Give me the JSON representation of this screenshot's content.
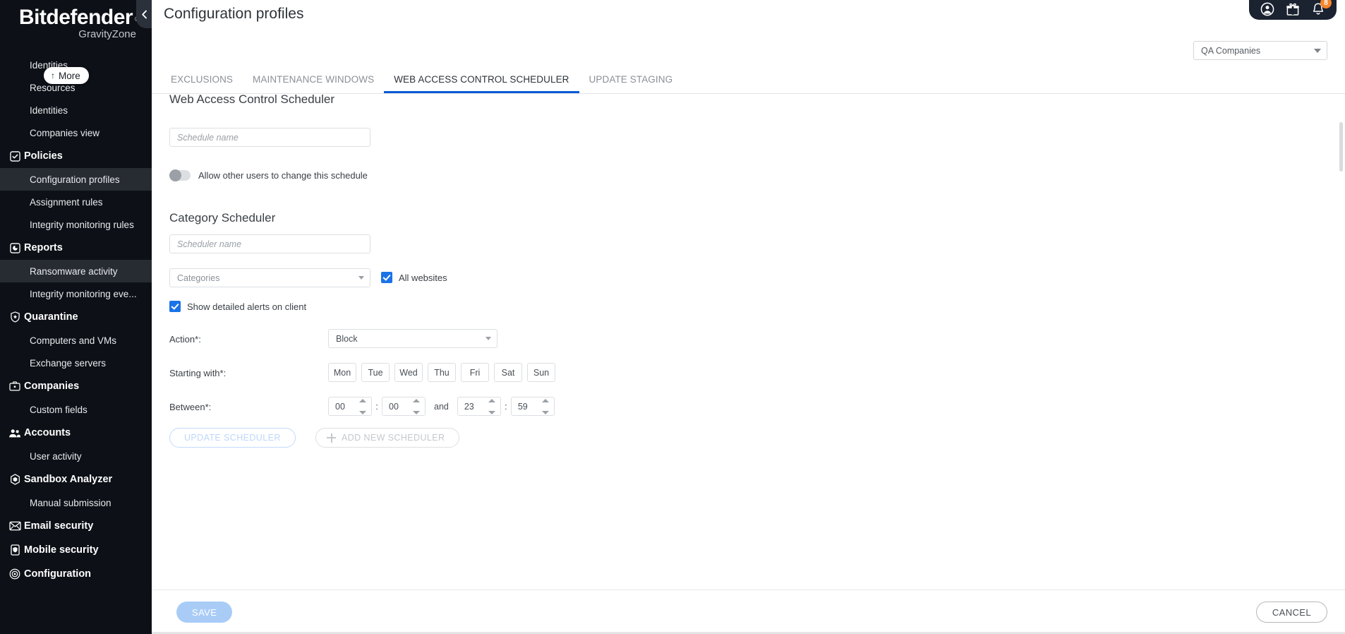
{
  "brand": {
    "name": "Bitdefender",
    "registered": "®",
    "product": "GravityZone"
  },
  "sidebar": {
    "more_pill": {
      "arrow": "↑",
      "label": "More"
    },
    "items": [
      {
        "label": "Identities",
        "type": "sub",
        "icon": "",
        "active": false
      },
      {
        "label": "Resources",
        "type": "sub",
        "icon": "",
        "active": false
      },
      {
        "label": "Identities",
        "type": "sub",
        "icon": "",
        "active": false
      },
      {
        "label": "Companies view",
        "type": "sub",
        "icon": "",
        "active": false
      },
      {
        "label": "Policies",
        "type": "group",
        "icon": "policies-icon",
        "active": false
      },
      {
        "label": "Configuration profiles",
        "type": "sub",
        "icon": "",
        "active": true
      },
      {
        "label": "Assignment rules",
        "type": "sub",
        "icon": "",
        "active": false
      },
      {
        "label": "Integrity monitoring rules",
        "type": "sub",
        "icon": "",
        "active": false
      },
      {
        "label": "Reports",
        "type": "group",
        "icon": "reports-icon",
        "active": false
      },
      {
        "label": "Ransomware activity",
        "type": "sub",
        "icon": "",
        "active": true
      },
      {
        "label": "Integrity monitoring eve...",
        "type": "sub",
        "icon": "",
        "active": false
      },
      {
        "label": "Quarantine",
        "type": "group",
        "icon": "quarantine-icon",
        "active": false
      },
      {
        "label": "Computers and VMs",
        "type": "sub",
        "icon": "",
        "active": false
      },
      {
        "label": "Exchange servers",
        "type": "sub",
        "icon": "",
        "active": false
      },
      {
        "label": "Companies",
        "type": "group",
        "icon": "companies-icon",
        "active": false
      },
      {
        "label": "Custom fields",
        "type": "sub",
        "icon": "",
        "active": false
      },
      {
        "label": "Accounts",
        "type": "group",
        "icon": "accounts-icon",
        "active": false
      },
      {
        "label": "User activity",
        "type": "sub",
        "icon": "",
        "active": false
      },
      {
        "label": "Sandbox Analyzer",
        "type": "group",
        "icon": "sandbox-icon",
        "active": false
      },
      {
        "label": "Manual submission",
        "type": "sub",
        "icon": "",
        "active": false
      },
      {
        "label": "Email security",
        "type": "group",
        "icon": "email-icon",
        "active": false
      },
      {
        "label": "Mobile security",
        "type": "group",
        "icon": "mobile-icon",
        "active": false
      },
      {
        "label": "Configuration",
        "type": "group",
        "icon": "configuration-icon",
        "active": false
      }
    ]
  },
  "topbar": {
    "notifications_badge": "8",
    "icons": [
      "account-icon",
      "gift-icon",
      "bell-icon"
    ]
  },
  "header": {
    "title": "Configuration profiles",
    "company_filter": "QA Companies"
  },
  "tabs": [
    {
      "label": "EXCLUSIONS",
      "active": false
    },
    {
      "label": "MAINTENANCE WINDOWS",
      "active": false
    },
    {
      "label": "WEB ACCESS CONTROL SCHEDULER",
      "active": true
    },
    {
      "label": "UPDATE STAGING",
      "active": false
    }
  ],
  "content": {
    "heading": "Web Access Control Scheduler",
    "schedule_name_placeholder": "Schedule name",
    "schedule_name_value": "",
    "allow_other_users_label": "Allow other users to change this schedule",
    "allow_other_users_on": false,
    "category_scheduler_heading": "Category Scheduler",
    "scheduler_name_placeholder": "Scheduler name",
    "scheduler_name_value": "",
    "categories_placeholder": "Categories",
    "all_websites_label": "All websites",
    "all_websites_checked": true,
    "show_detailed_alerts_label": "Show detailed alerts on client",
    "show_detailed_alerts_checked": true,
    "action_label": "Action*:",
    "action_value": "Block",
    "starting_with_label": "Starting with*:",
    "days": [
      "Mon",
      "Tue",
      "Wed",
      "Thu",
      "Fri",
      "Sat",
      "Sun"
    ],
    "between_label": "Between*:",
    "time": {
      "start_hour": "00",
      "start_minute": "00",
      "and": "and",
      "end_hour": "23",
      "end_minute": "59",
      "separator": ":"
    },
    "update_scheduler_label": "UPDATE SCHEDULER",
    "add_new_scheduler_label": "ADD NEW SCHEDULER"
  },
  "footer": {
    "save_label": "SAVE",
    "cancel_label": "CANCEL"
  },
  "colors": {
    "accent_blue": "#0a5ad4",
    "checkbox_blue": "#1a73e8",
    "badge_orange": "#f5842a",
    "sidebar_bg": "#0d1117",
    "save_disabled": "#a9ccf7"
  }
}
